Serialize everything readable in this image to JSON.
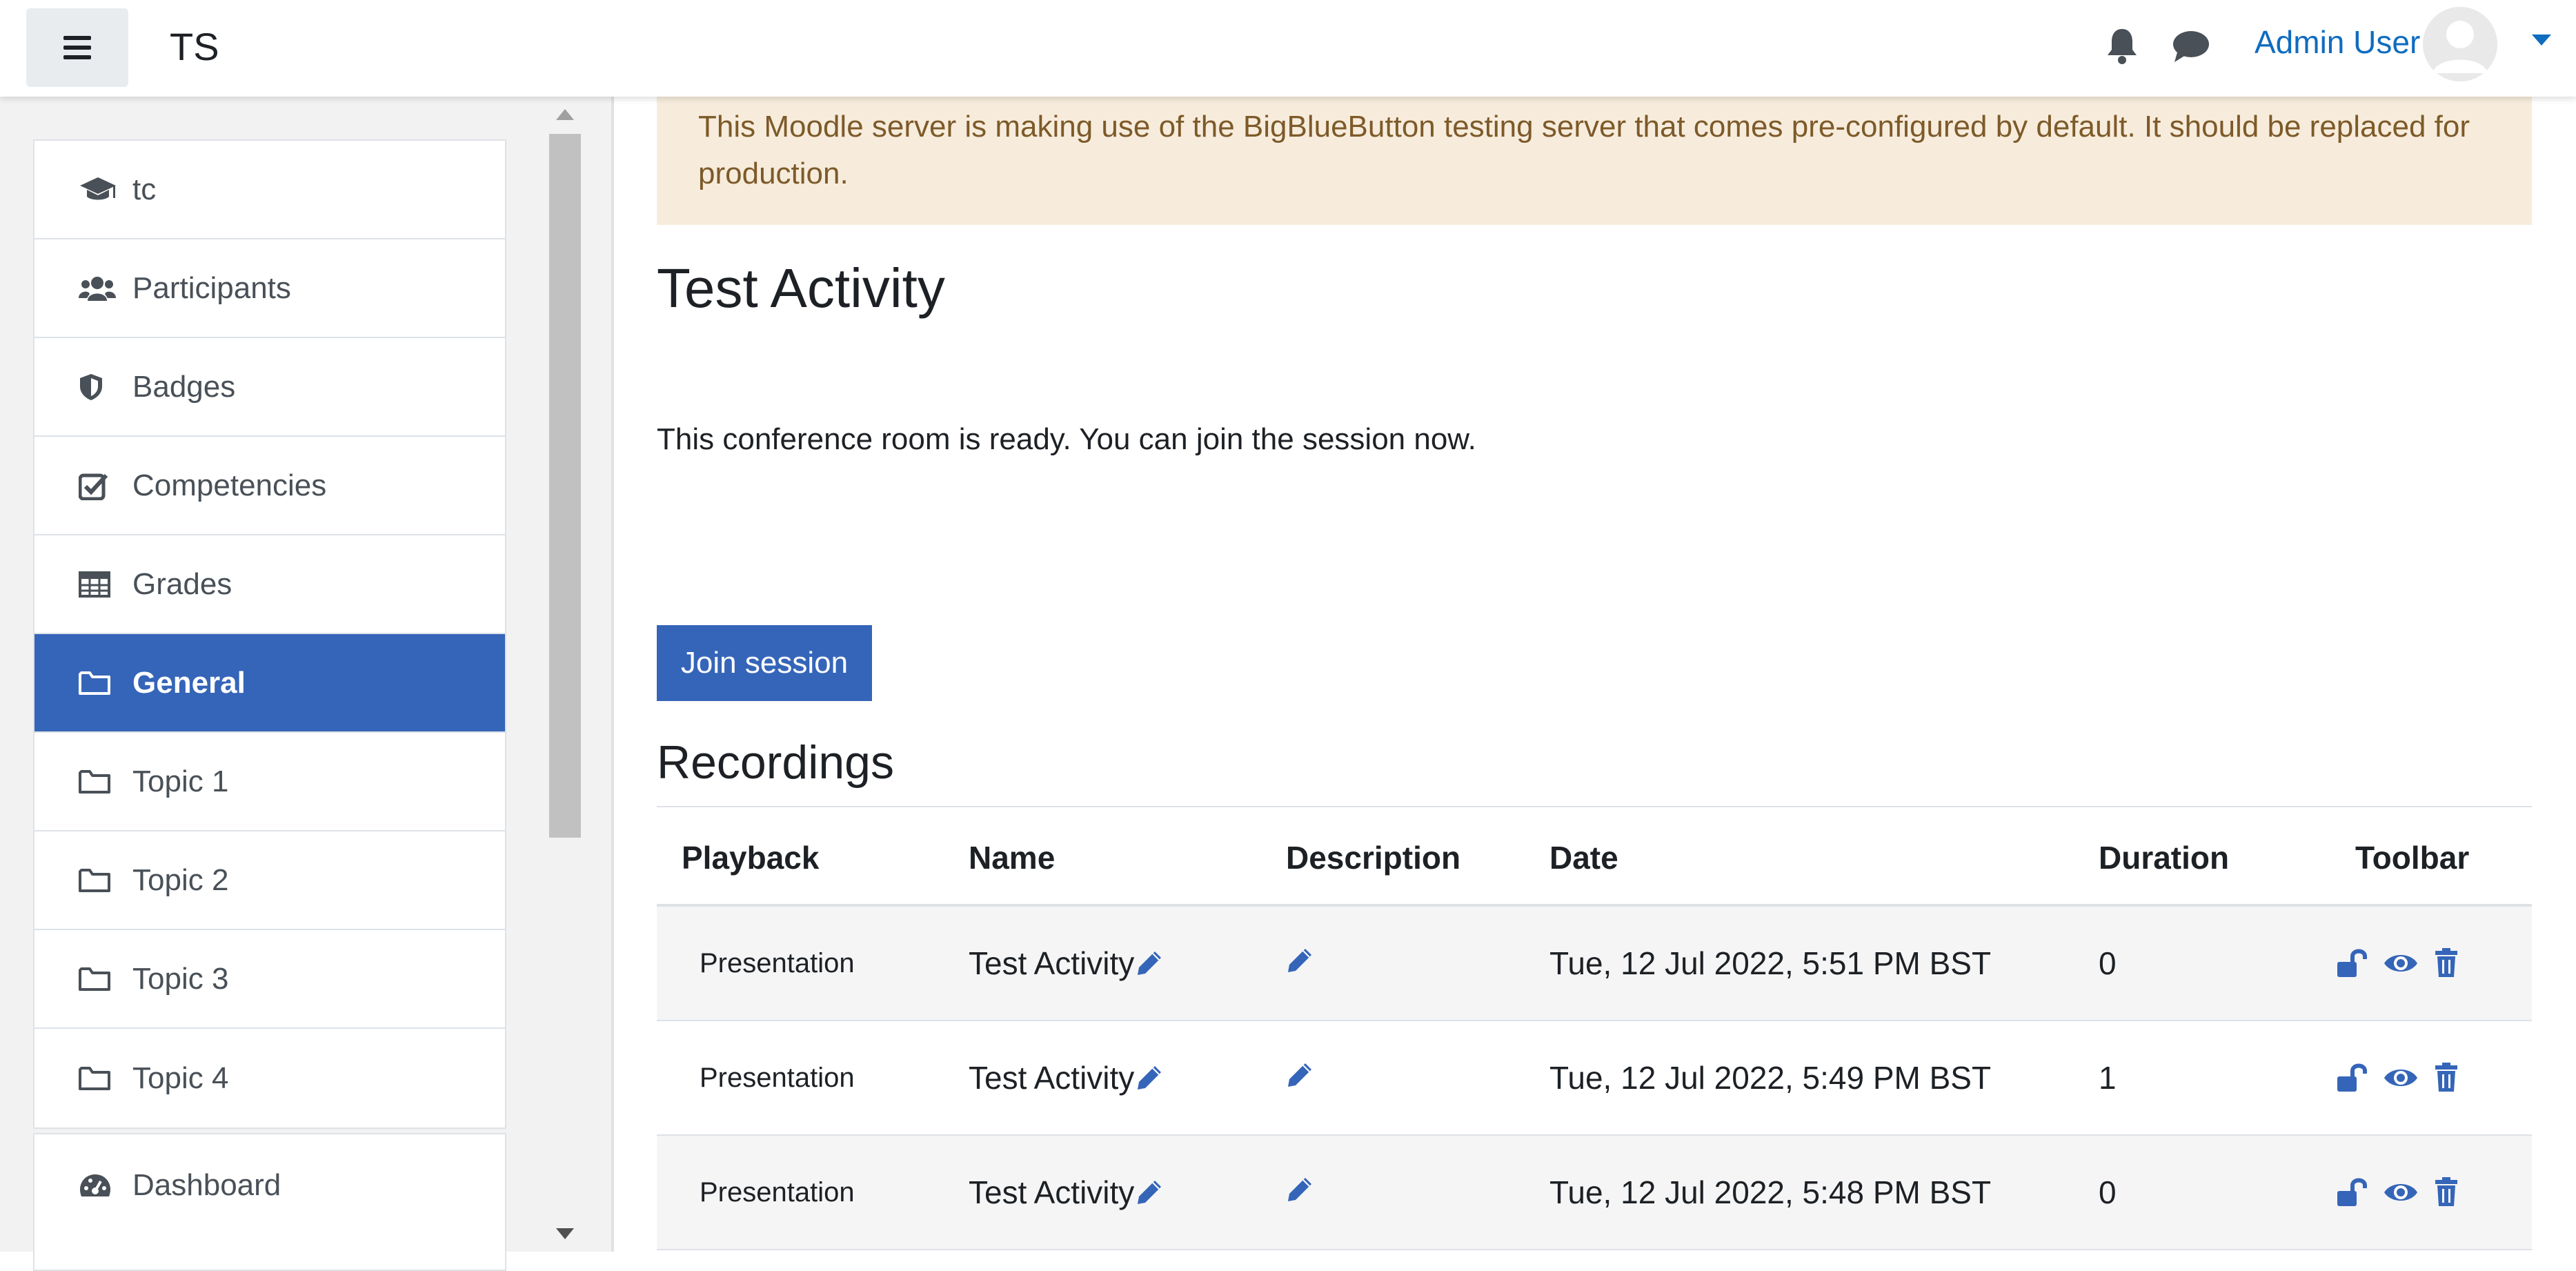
{
  "navbar": {
    "site_name": "TS",
    "user_name": "Admin User",
    "icons": [
      "menu-icon",
      "bell-icon",
      "chat-icon",
      "avatar",
      "caret-down-icon"
    ]
  },
  "drawer": {
    "items": [
      {
        "label": "tc",
        "icon": "graduation-cap-icon",
        "active": false
      },
      {
        "label": "Participants",
        "icon": "users-icon",
        "active": false
      },
      {
        "label": "Badges",
        "icon": "shield-icon",
        "active": false
      },
      {
        "label": "Competencies",
        "icon": "check-square-icon",
        "active": false
      },
      {
        "label": "Grades",
        "icon": "table-icon",
        "active": false
      },
      {
        "label": "General",
        "icon": "folder-icon",
        "active": true
      },
      {
        "label": "Topic 1",
        "icon": "folder-icon",
        "active": false
      },
      {
        "label": "Topic 2",
        "icon": "folder-icon",
        "active": false
      },
      {
        "label": "Topic 3",
        "icon": "folder-icon",
        "active": false
      },
      {
        "label": "Topic 4",
        "icon": "folder-icon",
        "active": false
      }
    ],
    "secondary_items": [
      {
        "label": "Dashboard",
        "icon": "dashboard-icon"
      }
    ]
  },
  "main": {
    "alert": "This Moodle server is making use of the BigBlueButton testing server that comes pre-configured by default. It should be replaced for production.",
    "title": "Test Activity",
    "status": "This conference room is ready. You can join the session now.",
    "join_label": "Join session",
    "recordings_title": "Recordings",
    "table": {
      "headers": {
        "playback": "Playback",
        "name": "Name",
        "description": "Description",
        "date": "Date",
        "duration": "Duration",
        "toolbar": "Toolbar"
      },
      "rows": [
        {
          "playback": "Presentation",
          "name": "Test Activity",
          "date": "Tue, 12 Jul 2022, 5:51 PM BST",
          "duration": "0"
        },
        {
          "playback": "Presentation",
          "name": "Test Activity",
          "date": "Tue, 12 Jul 2022, 5:49 PM BST",
          "duration": "1"
        },
        {
          "playback": "Presentation",
          "name": "Test Activity",
          "date": "Tue, 12 Jul 2022, 5:48 PM BST",
          "duration": "0"
        }
      ]
    }
  },
  "colors": {
    "brand": "#3565b8",
    "link": "#0f6cbf",
    "alert_bg": "#f7ecdc",
    "alert_text": "#7d5a29"
  }
}
